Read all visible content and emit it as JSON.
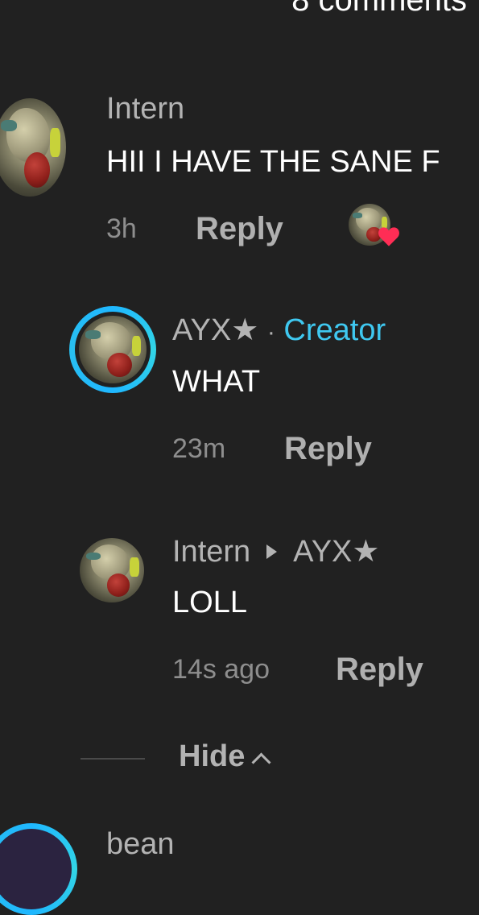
{
  "header": {
    "title": "8 comments"
  },
  "comments": [
    {
      "author": "Intern",
      "text": "HII I HAVE THE SANE F",
      "time": "3h",
      "reply_label": "Reply"
    },
    {
      "author": "AYX★",
      "separator": "·",
      "badge": "Creator",
      "text": "WHAT",
      "time": "23m",
      "reply_label": "Reply"
    },
    {
      "author": "Intern",
      "reply_to": "AYX★",
      "text": "LOLL",
      "time": "14s ago",
      "reply_label": "Reply"
    },
    {
      "author": "bean"
    }
  ],
  "hide_label": "Hide",
  "colors": {
    "background": "#212121",
    "creator": "#3fc8f0",
    "heart": "#ff2d55"
  },
  "icons": [
    "creator-liked-heart-icon",
    "chevron-up-icon",
    "reply-arrow-icon"
  ]
}
